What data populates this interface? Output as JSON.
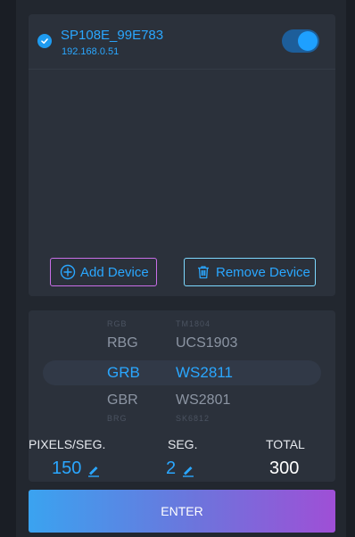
{
  "device": {
    "name": "SP108E_99E783",
    "ip": "192.168.0.51",
    "selected": true,
    "enabled": true
  },
  "buttons": {
    "add": "Add Device",
    "remove": "Remove Device",
    "enter": "ENTER"
  },
  "picker": {
    "color_orders": [
      "RGB",
      "RBG",
      "GRB",
      "GBR",
      "BRG"
    ],
    "chips": [
      "TM1804",
      "UCS1903",
      "WS2811",
      "WS2801",
      "SK6812"
    ],
    "selected_index": 2
  },
  "stats": {
    "pixels_label": "PIXELS/SEG.",
    "pixels_value": "150",
    "seg_label": "SEG.",
    "seg_value": "2",
    "total_label": "TOTAL",
    "total_value": "300"
  },
  "colors": {
    "accent": "#2aa7ff",
    "add_border": "#c96ee8",
    "remove_border": "#7dd9ff"
  },
  "icons": {
    "check": "check-circle-icon",
    "add": "plus-circle-icon",
    "remove": "trash-icon",
    "edit": "pencil-icon"
  }
}
